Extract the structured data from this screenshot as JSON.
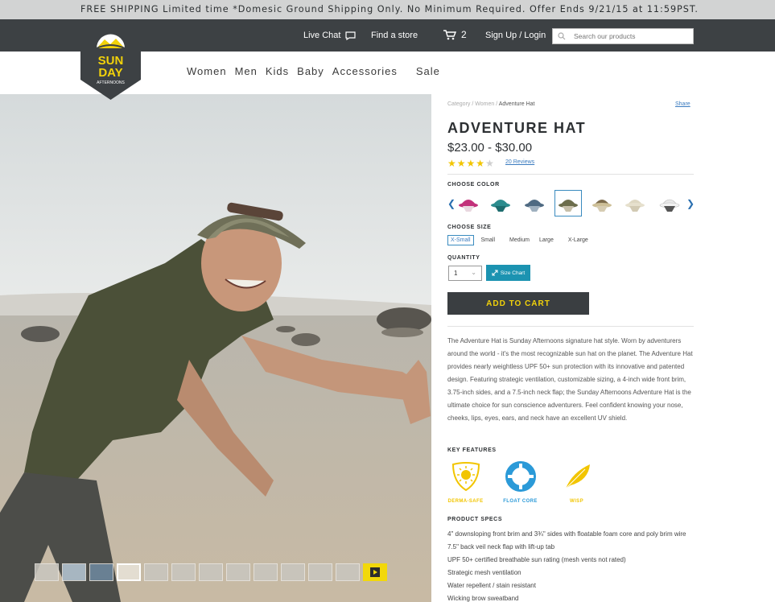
{
  "promo": {
    "text": "FREE SHIPPING Limited time   *Domesic Ground Shipping Only. No Minimum Required. Offer Ends 9/21/15 at 11:59PST."
  },
  "topnav": {
    "live_chat": "Live Chat",
    "find_store": "Find a store",
    "cart_count": "2",
    "signup": "Sign Up / Login",
    "search_placeholder": "Search our products"
  },
  "logo": {
    "line1": "SUN",
    "line2": "DAY",
    "line3": "AFTERNOONS"
  },
  "mainnav": {
    "items": [
      "Women",
      "Men",
      "Kids",
      "Baby",
      "Accessories"
    ],
    "sale": "Sale"
  },
  "breadcrumb": {
    "category": "Category",
    "sep": "/",
    "women": "Women",
    "current": "Adventure Hat"
  },
  "share": "Share",
  "product": {
    "title": "ADVENTURE HAT",
    "price": "$23.00 - $30.00",
    "rating": 4,
    "rating_max": 5,
    "reviews": "20 Reviews"
  },
  "color": {
    "label": "CHOOSE COLOR",
    "swatches": [
      "magenta-hat-icon",
      "teal-hat-icon",
      "slate-blue-hat-icon",
      "olive-hat-icon",
      "khaki-hat-icon",
      "cream-hat-icon",
      "white-hat-icon"
    ],
    "selected_index": 3
  },
  "size": {
    "label": "CHOOSE SIZE",
    "options": [
      "X-Small",
      "Small",
      "Medium",
      "Large",
      "X-Large"
    ],
    "selected": "X-Small"
  },
  "quantity": {
    "label": "QUANTITY",
    "value": "1",
    "size_chart": "Size Chart"
  },
  "add_to_cart": "ADD TO CART",
  "description": "The Adventure Hat is Sunday Afternoons signature hat style. Worn by adventurers around the world - it's the most recognizable sun hat on the planet. The Adventure Hat provides nearly weightless UPF 50+ sun protection with its innovative and patented design. Featuring strategic ventilation, customizable sizing, a 4-inch wide front brim, 3.75-inch sides, and a 7.5-inch neck flap; the Sunday Afternoons Adventure Hat is the ultimate choice for sun conscience adventurers. Feel confident knowing your nose, cheeks, lips, eyes, ears, and neck have an excellent UV shield.",
  "features": {
    "label": "KEY FEATURES",
    "items": [
      {
        "name": "DERMA-SAFE",
        "color": "#f2c500"
      },
      {
        "name": "FLOAT CORE",
        "color": "#2b9ad8"
      },
      {
        "name": "WISP",
        "color": "#f2c500"
      }
    ]
  },
  "specs": {
    "label": "PRODUCT SPECS",
    "items": [
      "4\" downsloping front brim and 3¾\" sides with floatable foam core and poly brim wire",
      "7.5\" back veil neck flap with lift-up tab",
      "UPF 50+ certified breathable sun rating (mesh vents not rated)",
      "Strategic mesh ventilation",
      "Water repellent / stain resistant",
      "Wicking brow sweatband"
    ]
  },
  "gallery": {
    "thumb_count": 13,
    "active_index": 3
  }
}
